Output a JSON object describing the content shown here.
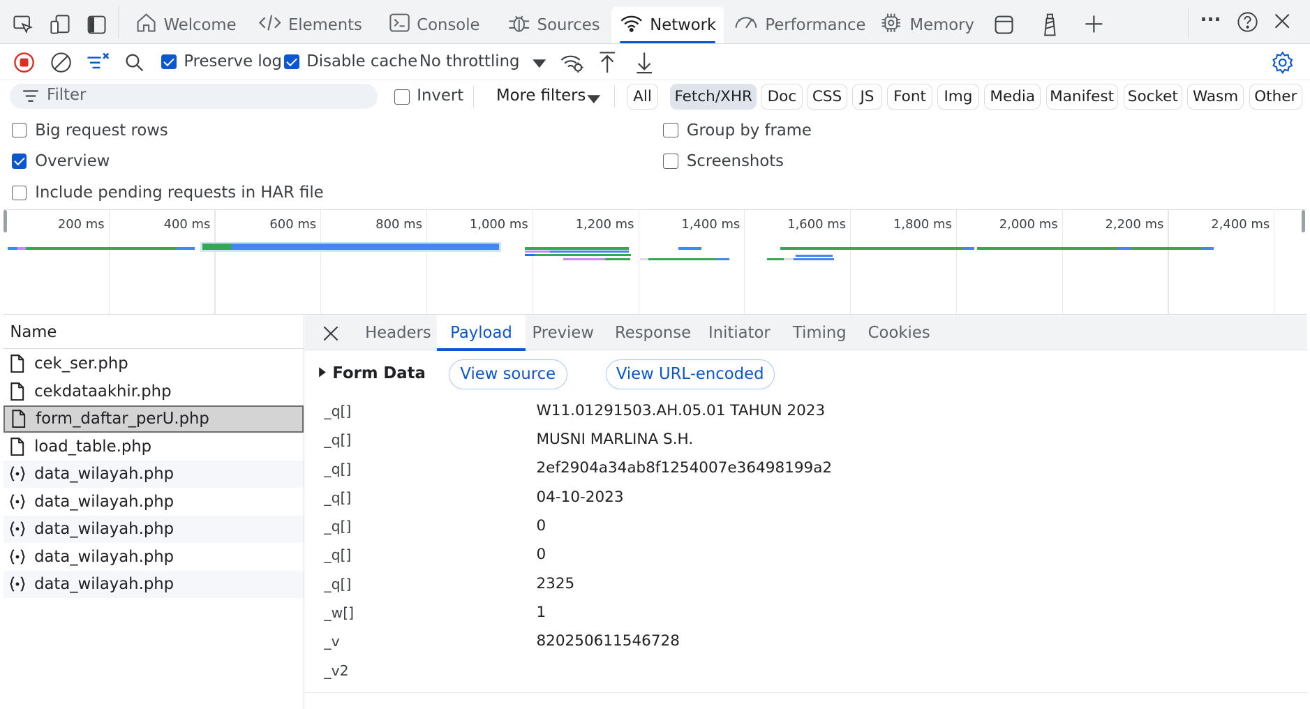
{
  "tabs": [
    {
      "label": "Welcome",
      "icon": "home-icon"
    },
    {
      "label": "Elements",
      "icon": "code-icon"
    },
    {
      "label": "Console",
      "icon": "console-icon"
    },
    {
      "label": "Sources",
      "icon": "bug-icon"
    },
    {
      "label": "Network",
      "icon": "wifi-icon",
      "active": true
    },
    {
      "label": "Performance",
      "icon": "gauge-icon"
    },
    {
      "label": "Memory",
      "icon": "chip-icon"
    }
  ],
  "toolbar": {
    "preserve_log": "Preserve log",
    "preserve_log_checked": true,
    "disable_cache": "Disable cache",
    "disable_cache_checked": true,
    "throttling": "No throttling"
  },
  "filter": {
    "placeholder": "Filter",
    "invert": "Invert",
    "more_filters": "More filters",
    "types": [
      "All",
      "Fetch/XHR",
      "Doc",
      "CSS",
      "JS",
      "Font",
      "Img",
      "Media",
      "Manifest",
      "Socket",
      "Wasm",
      "Other"
    ],
    "selected": "Fetch/XHR"
  },
  "settings": {
    "big_request_rows": "Big request rows",
    "overview": "Overview",
    "include_pending": "Include pending requests in HAR file",
    "group_by_frame": "Group by frame",
    "screenshots": "Screenshots"
  },
  "timeline": {
    "ticks": [
      "200 ms",
      "400 ms",
      "600 ms",
      "800 ms",
      "1,000 ms",
      "1,200 ms",
      "1,400 ms",
      "1,600 ms",
      "1,800 ms",
      "2,000 ms",
      "2,200 ms",
      "2,400 ms"
    ]
  },
  "requests": {
    "header": "Name",
    "items": [
      {
        "name": "cek_ser.php",
        "type": "doc"
      },
      {
        "name": "cekdataakhir.php",
        "type": "doc"
      },
      {
        "name": "form_daftar_perU.php",
        "type": "doc",
        "selected": true
      },
      {
        "name": "load_table.php",
        "type": "doc"
      },
      {
        "name": "data_wilayah.php",
        "type": "json"
      },
      {
        "name": "data_wilayah.php",
        "type": "json"
      },
      {
        "name": "data_wilayah.php",
        "type": "json"
      },
      {
        "name": "data_wilayah.php",
        "type": "json"
      },
      {
        "name": "data_wilayah.php",
        "type": "json"
      }
    ]
  },
  "detail": {
    "tabs": [
      "Headers",
      "Payload",
      "Preview",
      "Response",
      "Initiator",
      "Timing",
      "Cookies"
    ],
    "active_tab": "Payload",
    "section": "Form Data",
    "view_source": "View source",
    "view_url_encoded": "View URL-encoded",
    "fields": [
      {
        "key": "_q[]",
        "value": "W11.01291503.AH.05.01 TAHUN 2023"
      },
      {
        "key": "_q[]",
        "value": "MUSNI MARLINA S.H."
      },
      {
        "key": "_q[]",
        "value": "2ef2904a34ab8f1254007e36498199a2"
      },
      {
        "key": "_q[]",
        "value": "04-10-2023"
      },
      {
        "key": "_q[]",
        "value": "0"
      },
      {
        "key": "_q[]",
        "value": "0"
      },
      {
        "key": "_q[]",
        "value": "2325"
      },
      {
        "key": "_w[]",
        "value": "1"
      },
      {
        "key": "_v",
        "value": "820250611546728"
      },
      {
        "key": "_v2",
        "value": ""
      }
    ]
  },
  "colors": {
    "accent": "#0b57d0",
    "bar_green": "#34a853",
    "bar_blue": "#4285f4",
    "bar_purple": "#c58af9",
    "record_red": "#d93025"
  }
}
